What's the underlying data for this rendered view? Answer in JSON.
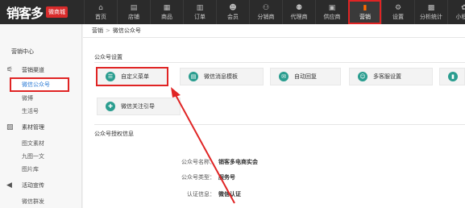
{
  "logo": {
    "text": "销客多",
    "badge": "微商城"
  },
  "nav": [
    {
      "label": "首页",
      "icon": "home-icon",
      "glyph": "⌂"
    },
    {
      "label": "店铺",
      "icon": "store-icon",
      "glyph": "▤"
    },
    {
      "label": "商品",
      "icon": "goods-icon",
      "glyph": "▦"
    },
    {
      "label": "订单",
      "icon": "order-icon",
      "glyph": "▥"
    },
    {
      "label": "会员",
      "icon": "member-icon",
      "glyph": "☻"
    },
    {
      "label": "分销商",
      "icon": "distributor-icon",
      "glyph": "⚇"
    },
    {
      "label": "代理商",
      "icon": "agent-icon",
      "glyph": "⚉"
    },
    {
      "label": "供应商",
      "icon": "supplier-icon",
      "glyph": "▣"
    },
    {
      "label": "营销",
      "icon": "marketing-icon",
      "glyph": "▮"
    },
    {
      "label": "设置",
      "icon": "settings-icon",
      "glyph": "⚙"
    },
    {
      "label": "分析统计",
      "icon": "analytics-icon",
      "glyph": "▩"
    },
    {
      "label": "小程序",
      "icon": "miniprogram-icon",
      "glyph": "✿"
    }
  ],
  "sidebar": {
    "items": [
      {
        "label": "营销中心"
      },
      {
        "label": "营销渠道",
        "icon": "channel-icon",
        "glyph": "⚟"
      },
      {
        "label": "微信公众号"
      },
      {
        "label": "微博"
      },
      {
        "label": "生活号"
      },
      {
        "label": "素材管理",
        "icon": "material-icon",
        "glyph": "▨"
      },
      {
        "label": "图文素材"
      },
      {
        "label": "九图一文"
      },
      {
        "label": "图片库"
      },
      {
        "label": "活动宣传",
        "icon": "promo-icon",
        "glyph": "◀"
      },
      {
        "label": "微信群发"
      }
    ]
  },
  "breadcrumb": {
    "root": "营销",
    "sep": ">",
    "current": "微信公众号"
  },
  "settings": {
    "title": "公众号设置",
    "features": [
      {
        "label": "自定义菜单",
        "glyph": "☰"
      },
      {
        "label": "微信消息模板",
        "glyph": "▤"
      },
      {
        "label": "自动回复",
        "glyph": "✉"
      },
      {
        "label": "多客服设置",
        "glyph": "☺"
      },
      {
        "label": "",
        "glyph": "▮"
      },
      {
        "label": "微信关注引导",
        "glyph": "✚"
      }
    ]
  },
  "auth": {
    "title": "公众号授权信息",
    "rows": [
      {
        "key": "公众号名称：",
        "value": "销客多电商实会"
      },
      {
        "key": "公众号类型：",
        "value": "服务号"
      },
      {
        "key": "认证信息：",
        "value": "微信认证"
      }
    ]
  }
}
